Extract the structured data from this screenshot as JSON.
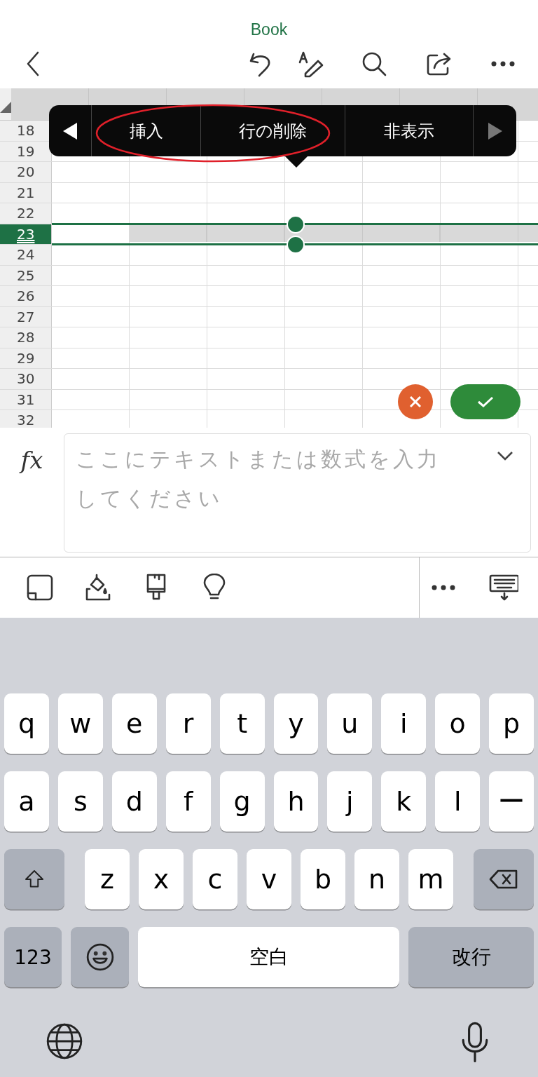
{
  "title": "Book",
  "sheet": {
    "rows": [
      {
        "label": "18",
        "selected": false
      },
      {
        "label": "19",
        "selected": false
      },
      {
        "label": "20",
        "selected": false
      },
      {
        "label": "21",
        "selected": false
      },
      {
        "label": "22",
        "selected": false
      },
      {
        "label": "23",
        "selected": true
      },
      {
        "label": "24",
        "selected": false
      },
      {
        "label": "25",
        "selected": false
      },
      {
        "label": "26",
        "selected": false
      },
      {
        "label": "27",
        "selected": false
      },
      {
        "label": "28",
        "selected": false
      },
      {
        "label": "29",
        "selected": false
      },
      {
        "label": "30",
        "selected": false
      },
      {
        "label": "31",
        "selected": false
      },
      {
        "label": "32",
        "selected": false
      }
    ]
  },
  "context_menu": {
    "items": [
      {
        "kind": "prev",
        "disabled": false
      },
      {
        "kind": "text",
        "label": "挿入"
      },
      {
        "kind": "text",
        "label": "行の削除"
      },
      {
        "kind": "text",
        "label": "非表示"
      },
      {
        "kind": "next",
        "disabled": true
      }
    ]
  },
  "formula_bar": {
    "label": "fx",
    "placeholder": "ここにテキストまたは数式を入力してください"
  },
  "keyboard": {
    "letter_rows": [
      [
        "q",
        "w",
        "e",
        "r",
        "t",
        "y",
        "u",
        "i",
        "o",
        "p"
      ],
      [
        "a",
        "s",
        "d",
        "f",
        "g",
        "h",
        "j",
        "k",
        "l",
        "ー"
      ],
      [
        "z",
        "x",
        "c",
        "v",
        "b",
        "n",
        "m"
      ]
    ],
    "numbers_key": "123",
    "space_key": "空白",
    "return_key": "改行"
  }
}
